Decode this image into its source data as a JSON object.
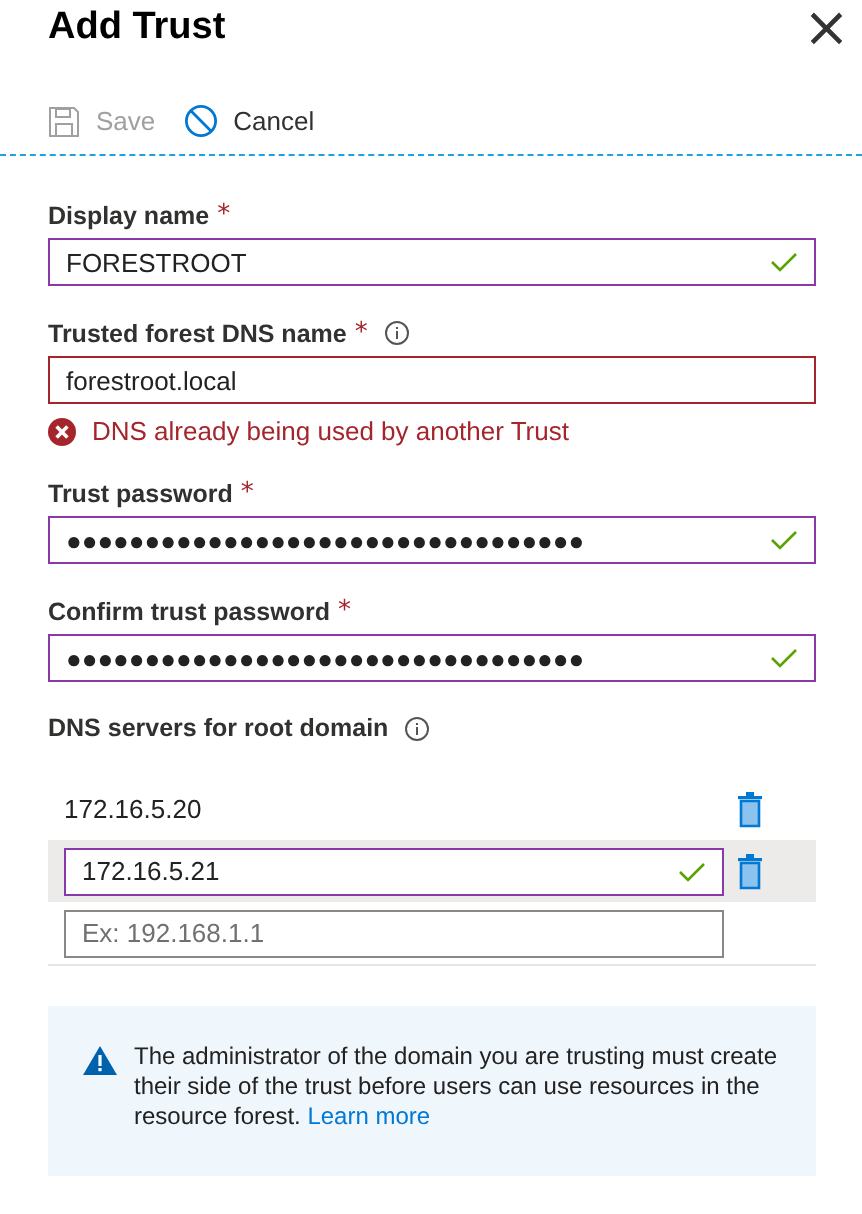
{
  "window": {
    "title": "Add Trust",
    "close": "×"
  },
  "toolbar": [
    {
      "kind": "save",
      "label": "Save",
      "disabled": true
    },
    {
      "kind": "cancel",
      "label": "Cancel",
      "disabled": false
    }
  ],
  "fields": [
    {
      "label": "Display name",
      "required_mark": "*",
      "info": false,
      "value": "FORESTROOT",
      "valid": true
    },
    {
      "label": "Trusted forest DNS name",
      "required_mark": "*",
      "info": true,
      "value": "forestroot.local",
      "valid": false,
      "error": "DNS already being used by another Trust"
    },
    {
      "label": "Trust password",
      "required_mark": "*",
      "info": false,
      "value": "●●●●●●●●●●●●●●●●●●●●●●●●●●●●●●●●●",
      "valid": true
    },
    {
      "label": "Confirm trust password",
      "required_mark": "*",
      "info": false,
      "value": "●●●●●●●●●●●●●●●●●●●●●●●●●●●●●●●●●",
      "valid": true
    }
  ],
  "dns_servers": {
    "label": "DNS servers for root domain",
    "info": true,
    "rows": [
      {
        "kind": "text",
        "value": "172.16.5.20",
        "selected": false,
        "deletable": true
      },
      {
        "kind": "input",
        "value": "172.16.5.21",
        "valid": true,
        "selected": true,
        "deletable": true
      },
      {
        "kind": "input",
        "placeholder": "Ex: 192.168.1.1",
        "selected": false,
        "deletable": false
      }
    ]
  },
  "notice": {
    "kind": "warning",
    "text": "The administrator of the domain you are trusting must create their side of the trust before users can use resources in the resource forest.",
    "link": "Learn more"
  }
}
